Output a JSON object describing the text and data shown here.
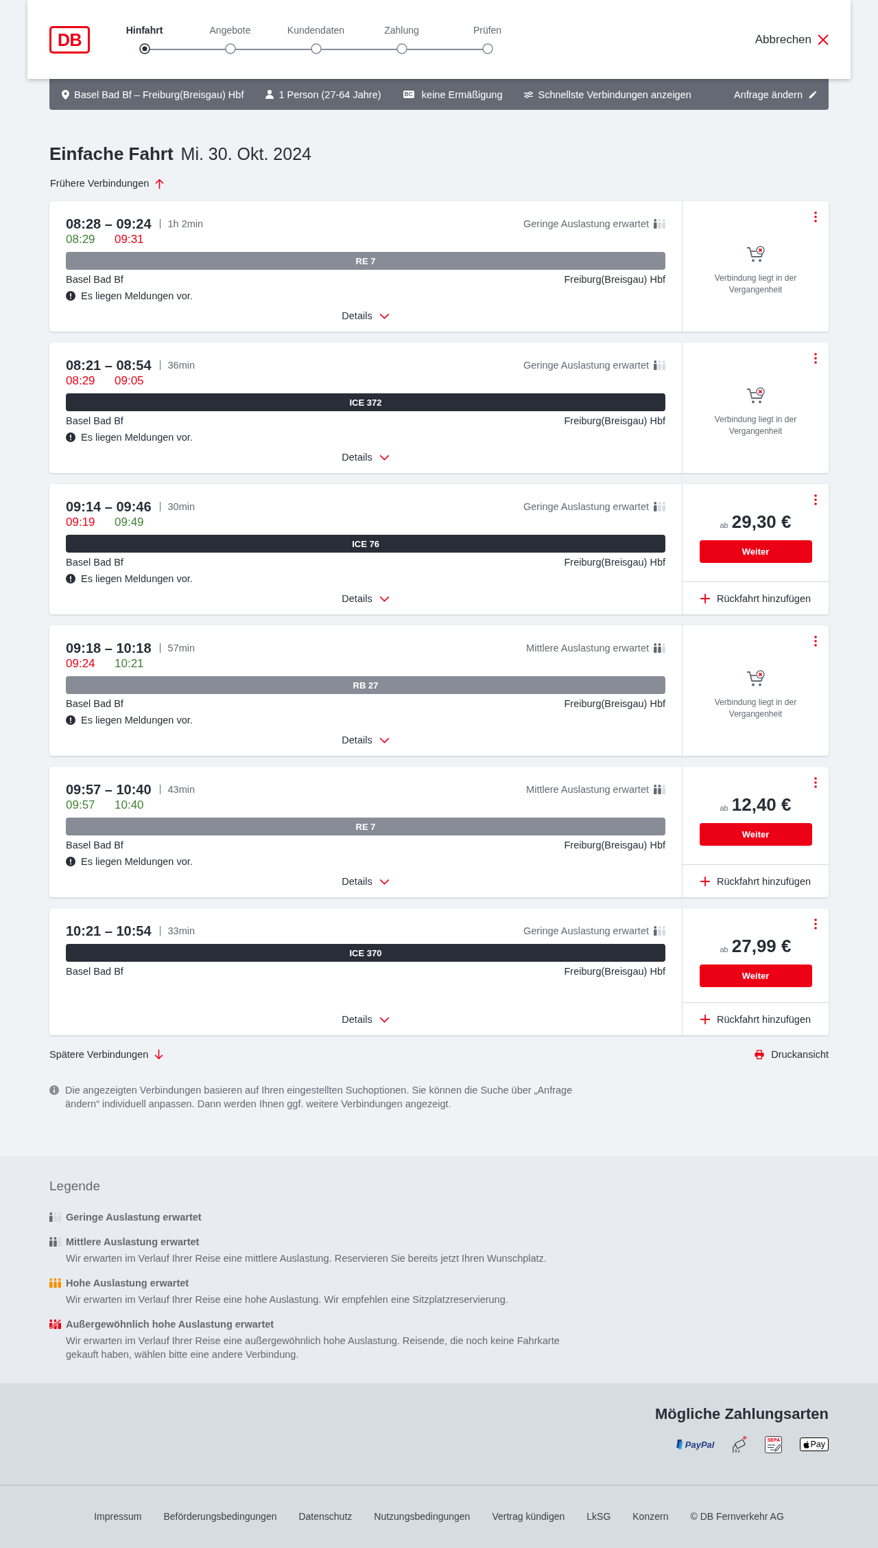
{
  "header": {
    "logo": "DB",
    "steps": [
      {
        "label": "Hinfahrt",
        "selected": true
      },
      {
        "label": "Angebote",
        "selected": false
      },
      {
        "label": "Kundendaten",
        "selected": false
      },
      {
        "label": "Zahlung",
        "selected": false
      },
      {
        "label": "Prüfen",
        "selected": false
      }
    ],
    "cancel": "Abbrechen"
  },
  "query_bar": {
    "route": "Basel Bad Bf – Freiburg(Breisgau) Hbf",
    "passengers": "1 Person (27-64 Jahre)",
    "discount_badge": "BC",
    "discount": "keine Ermäßigung",
    "sorting": "Schnellste Verbindungen anzeigen",
    "edit": "Anfrage ändern"
  },
  "heading": {
    "title": "Einfache Fahrt",
    "date": "Mi. 30. Okt. 2024"
  },
  "earlier": "Frühere Verbindungen",
  "connections": [
    {
      "times": "08:28 – 09:24",
      "duration": "1h 2min",
      "occupancy": {
        "kind": "low",
        "label": "Geringe Auslastung erwartet"
      },
      "realtime": [
        {
          "time": "08:29",
          "late": false
        },
        {
          "time": "09:31",
          "late": true
        }
      ],
      "train": {
        "kind": "regional",
        "label": "RE 7"
      },
      "from": "Basel Bad Bf",
      "to": "Freiburg(Breisgau) Hbf",
      "notice": "Es liegen Meldungen vor.",
      "details": "Details",
      "offer": {
        "kind": "past",
        "text": "Verbindung liegt in der Vergangenheit"
      }
    },
    {
      "times": "08:21 – 08:54",
      "duration": "36min",
      "occupancy": {
        "kind": "low",
        "label": "Geringe Auslastung erwartet"
      },
      "realtime": [
        {
          "time": "08:29",
          "late": true
        },
        {
          "time": "09:05",
          "late": true
        }
      ],
      "train": {
        "kind": "longdistance",
        "label": "ICE 372"
      },
      "from": "Basel Bad Bf",
      "to": "Freiburg(Breisgau) Hbf",
      "notice": "Es liegen Meldungen vor.",
      "details": "Details",
      "offer": {
        "kind": "past",
        "text": "Verbindung liegt in der Vergangenheit"
      }
    },
    {
      "times": "09:14 – 09:46",
      "duration": "30min",
      "occupancy": {
        "kind": "low",
        "label": "Geringe Auslastung erwartet"
      },
      "realtime": [
        {
          "time": "09:19",
          "late": true
        },
        {
          "time": "09:49",
          "late": false
        }
      ],
      "train": {
        "kind": "longdistance",
        "label": "ICE 76"
      },
      "from": "Basel Bad Bf",
      "to": "Freiburg(Breisgau) Hbf",
      "notice": "Es liegen Meldungen vor.",
      "details": "Details",
      "offer": {
        "kind": "price",
        "prefix": "ab",
        "price": "29,30 €",
        "button": "Weiter",
        "return": "Rückfahrt hinzufügen"
      }
    },
    {
      "times": "09:18 – 10:18",
      "duration": "57min",
      "occupancy": {
        "kind": "medium",
        "label": "Mittlere Auslastung erwartet"
      },
      "realtime": [
        {
          "time": "09:24",
          "late": true
        },
        {
          "time": "10:21",
          "late": false
        }
      ],
      "train": {
        "kind": "regional",
        "label": "RB 27"
      },
      "from": "Basel Bad Bf",
      "to": "Freiburg(Breisgau) Hbf",
      "notice": "Es liegen Meldungen vor.",
      "details": "Details",
      "offer": {
        "kind": "past",
        "text": "Verbindung liegt in der Vergangenheit"
      }
    },
    {
      "times": "09:57 – 10:40",
      "duration": "43min",
      "occupancy": {
        "kind": "medium",
        "label": "Mittlere Auslastung erwartet"
      },
      "realtime": [
        {
          "time": "09:57",
          "late": false
        },
        {
          "time": "10:40",
          "late": false
        }
      ],
      "train": {
        "kind": "regional",
        "label": "RE 7"
      },
      "from": "Basel Bad Bf",
      "to": "Freiburg(Breisgau) Hbf",
      "notice": "Es liegen Meldungen vor.",
      "details": "Details",
      "offer": {
        "kind": "price",
        "prefix": "ab",
        "price": "12,40 €",
        "button": "Weiter",
        "return": "Rückfahrt hinzufügen"
      }
    },
    {
      "times": "10:21 – 10:54",
      "duration": "33min",
      "occupancy": {
        "kind": "low",
        "label": "Geringe Auslastung erwartet"
      },
      "train": {
        "kind": "longdistance",
        "label": "ICE 370"
      },
      "from": "Basel Bad Bf",
      "to": "Freiburg(Breisgau) Hbf",
      "details": "Details",
      "offer": {
        "kind": "price",
        "prefix": "ab",
        "price": "27,99 €",
        "button": "Weiter",
        "return": "Rückfahrt hinzufügen"
      }
    }
  ],
  "later": "Spätere Verbindungen",
  "print": "Druckansicht",
  "info": "Die angezeigten Verbindungen basieren auf Ihren eingestellten Suchoptionen. Sie können die Suche über „Anfrage ändern“ individuell anpassen. Dann werden Ihnen ggf. weitere Verbindungen angezeigt.",
  "legend": {
    "title": "Legende",
    "items": [
      {
        "kind": "low",
        "title": "Geringe Auslastung erwartet"
      },
      {
        "kind": "medium",
        "title": "Mittlere Auslastung erwartet",
        "text": "Wir erwarten im Verlauf Ihrer Reise eine mittlere Auslastung. Reservieren Sie bereits jetzt Ihren Wunschplatz."
      },
      {
        "kind": "high",
        "title": "Hohe Auslastung erwartet",
        "text": "Wir erwarten im Verlauf Ihrer Reise eine hohe Auslastung. Wir empfehlen eine Sitzplatzreservierung."
      },
      {
        "kind": "extreme",
        "title": "Außergewöhnlich hohe Auslastung erwartet",
        "text": "Wir erwarten im Verlauf Ihrer Reise eine außergewöhnlich hohe Auslastung. Reisende, die noch keine Fahrkarte gekauft haben, wählen bitte eine andere Verbindung."
      }
    ]
  },
  "payment": {
    "title": "Mögliche Zahlungsarten",
    "methods": [
      {
        "kind": "paypal",
        "label": "PayPal"
      },
      {
        "kind": "contactless"
      },
      {
        "kind": "sepa",
        "label": "SEPA"
      },
      {
        "kind": "applepay",
        "label": "Pay"
      }
    ]
  },
  "footer_links": [
    "Impressum",
    "Beförderungsbedingungen",
    "Datenschutz",
    "Nutzungsbedingungen",
    "Vertrag kündigen",
    "LkSG",
    "Konzern",
    "© DB Fernverkehr AG"
  ]
}
